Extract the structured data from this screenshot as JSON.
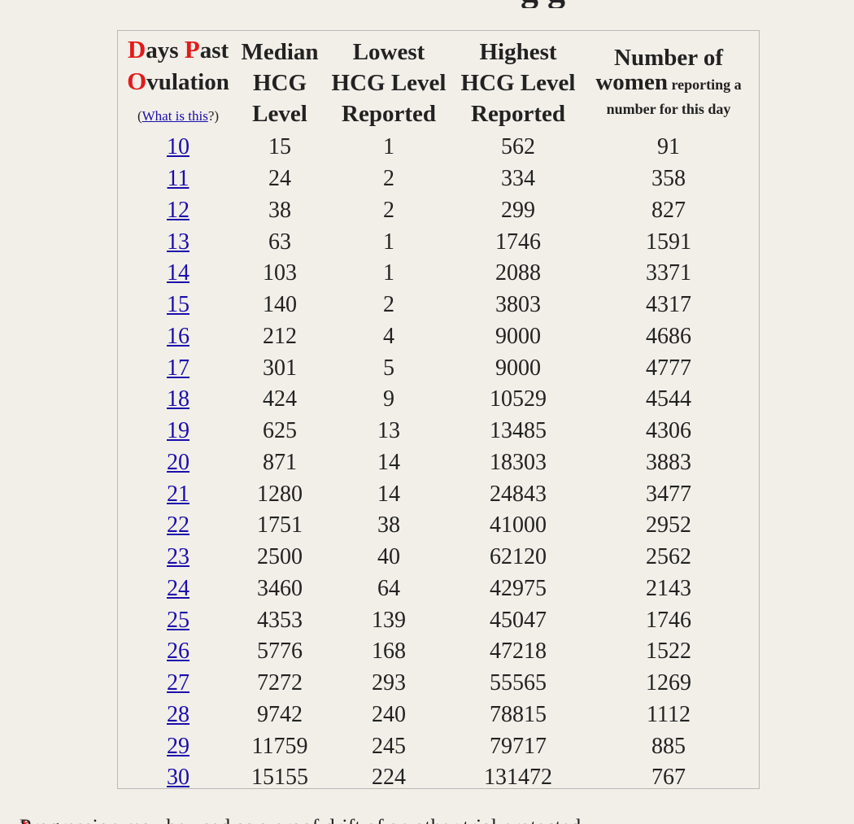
{
  "header": {
    "col1": {
      "d": "D",
      "ays": "ays ",
      "p": "P",
      "ast": "ast",
      "o": "O",
      "vulation": "vulation",
      "help_link": "What is this",
      "help_suffix": "?)",
      "help_prefix": "("
    },
    "col2": {
      "l1": "Median",
      "l2": "HCG",
      "l3": "Level"
    },
    "col3": {
      "l1": "Lowest",
      "l2": "HCG Level",
      "l3": "Reported"
    },
    "col4": {
      "l1": "Highest",
      "l2": "HCG Level",
      "l3": "Reported"
    },
    "col5": {
      "l1": "Number of",
      "l2a": "women",
      "l2b": " reporting a",
      "l3": "number for this day"
    }
  },
  "rows": [
    {
      "day": "10",
      "median": "15",
      "lowest": "1",
      "highest": "562",
      "women": "91"
    },
    {
      "day": "11",
      "median": "24",
      "lowest": "2",
      "highest": "334",
      "women": "358"
    },
    {
      "day": "12",
      "median": "38",
      "lowest": "2",
      "highest": "299",
      "women": "827"
    },
    {
      "day": "13",
      "median": "63",
      "lowest": "1",
      "highest": "1746",
      "women": "1591"
    },
    {
      "day": "14",
      "median": "103",
      "lowest": "1",
      "highest": "2088",
      "women": "3371"
    },
    {
      "day": "15",
      "median": "140",
      "lowest": "2",
      "highest": "3803",
      "women": "4317"
    },
    {
      "day": "16",
      "median": "212",
      "lowest": "4",
      "highest": "9000",
      "women": "4686"
    },
    {
      "day": "17",
      "median": "301",
      "lowest": "5",
      "highest": "9000",
      "women": "4777"
    },
    {
      "day": "18",
      "median": "424",
      "lowest": "9",
      "highest": "10529",
      "women": "4544"
    },
    {
      "day": "19",
      "median": "625",
      "lowest": "13",
      "highest": "13485",
      "women": "4306"
    },
    {
      "day": "20",
      "median": "871",
      "lowest": "14",
      "highest": "18303",
      "women": "3883"
    },
    {
      "day": "21",
      "median": "1280",
      "lowest": "14",
      "highest": "24843",
      "women": "3477"
    },
    {
      "day": "22",
      "median": "1751",
      "lowest": "38",
      "highest": "41000",
      "women": "2952"
    },
    {
      "day": "23",
      "median": "2500",
      "lowest": "40",
      "highest": "62120",
      "women": "2562"
    },
    {
      "day": "24",
      "median": "3460",
      "lowest": "64",
      "highest": "42975",
      "women": "2143"
    },
    {
      "day": "25",
      "median": "4353",
      "lowest": "139",
      "highest": "45047",
      "women": "1746"
    },
    {
      "day": "26",
      "median": "5776",
      "lowest": "168",
      "highest": "47218",
      "women": "1522"
    },
    {
      "day": "27",
      "median": "7272",
      "lowest": "293",
      "highest": "55565",
      "women": "1269"
    },
    {
      "day": "28",
      "median": "9742",
      "lowest": "240",
      "highest": "78815",
      "women": "1112"
    },
    {
      "day": "29",
      "median": "11759",
      "lowest": "245",
      "highest": "79717",
      "women": "885"
    },
    {
      "day": "30",
      "median": "15155",
      "lowest": "224",
      "highest": "131472",
      "women": "767"
    }
  ],
  "footnote": {
    "star": "*",
    "text": " Progression may be used as a proof drift of an other trial protected"
  },
  "colors": {
    "link": "#1a0dab",
    "accent_red": "#e21b1b",
    "background": "#f2efe9"
  }
}
